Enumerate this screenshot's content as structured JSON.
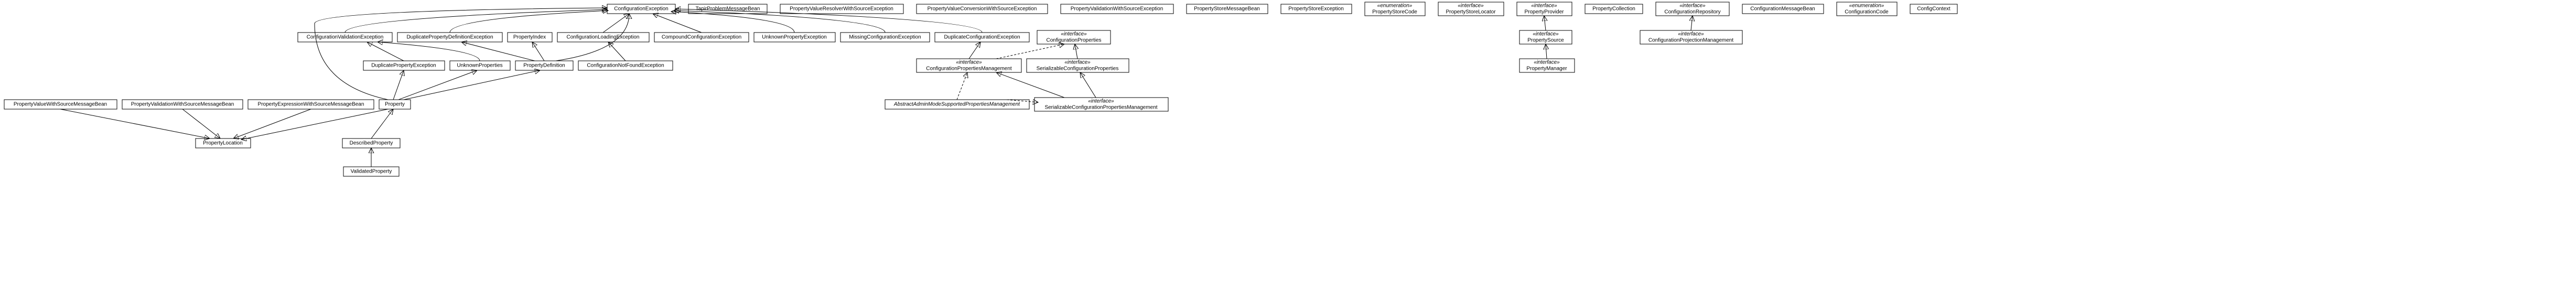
{
  "stereo": "«interface»",
  "enum": "«enumeration»",
  "nodes": {
    "ConfigurationException": "ConfigurationException",
    "TapirProblemMessageBean": "TapirProblemMessageBean",
    "PropertyValueResolverWithSourceException": "PropertyValueResolverWithSourceException",
    "PropertyValueConversionWithSourceException": "PropertyValueConversionWithSourceException",
    "PropertyValidationWithSourceException": "PropertyValidationWithSourceException",
    "PropertyStoreMessageBean": "PropertyStoreMessageBean",
    "PropertyStoreException": "PropertyStoreException",
    "PropertyStoreCode": "PropertyStoreCode",
    "PropertyStoreLocator": "PropertyStoreLocator",
    "PropertyProvider": "PropertyProvider",
    "PropertyCollection": "PropertyCollection",
    "ConfigurationRepository": "ConfigurationRepository",
    "ConfigurationMessageBean": "ConfigurationMessageBean",
    "ConfigurationCode": "ConfigurationCode",
    "ConfigContext": "ConfigContext",
    "ConfigurationValidationException": "ConfigurationValidationException",
    "DuplicatePropertyDefinitionException": "DuplicatePropertyDefinitionException",
    "PropertyIndex": "PropertyIndex",
    "ConfigurationLoadingException": "ConfigurationLoadingException",
    "CompoundConfigurationException": "CompoundConfigurationException",
    "UnknownPropertyException": "UnknownPropertyException",
    "MissingConfigurationException": "MissingConfigurationException",
    "DuplicateConfigurationException": "DuplicateConfigurationException",
    "ConfigurationProperties": "ConfigurationProperties",
    "PropertySource": "PropertySource",
    "ConfigurationProjectionManagement": "ConfigurationProjectionManagement",
    "DuplicatePropertyException": "DuplicatePropertyException",
    "UnknownProperties": "UnknownProperties",
    "PropertyDefinition": "PropertyDefinition",
    "ConfigurationNotFoundException": "ConfigurationNotFoundException",
    "ConfigurationPropertiesManagement": "ConfigurationPropertiesManagement",
    "SerializableConfigurationProperties": "SerializableConfigurationProperties",
    "PropertyManager": "PropertyManager",
    "PropertyValueWithSourceMessageBean": "PropertyValueWithSourceMessageBean",
    "PropertyValidationWithSourceMessageBean": "PropertyValidationWithSourceMessageBean",
    "PropertyExpressionWithSourceMessageBean": "PropertyExpressionWithSourceMessageBean",
    "Property": "Property",
    "AbstractAdminModeSupportedPropertiesManagement": "AbstractAdminModeSupportedPropertiesManagement",
    "SerializableConfigurationPropertiesManagement": "SerializableConfigurationPropertiesManagement",
    "PropertyLocation": "PropertyLocation",
    "DescribedProperty": "DescribedProperty",
    "ValidatedProperty": "ValidatedProperty"
  }
}
